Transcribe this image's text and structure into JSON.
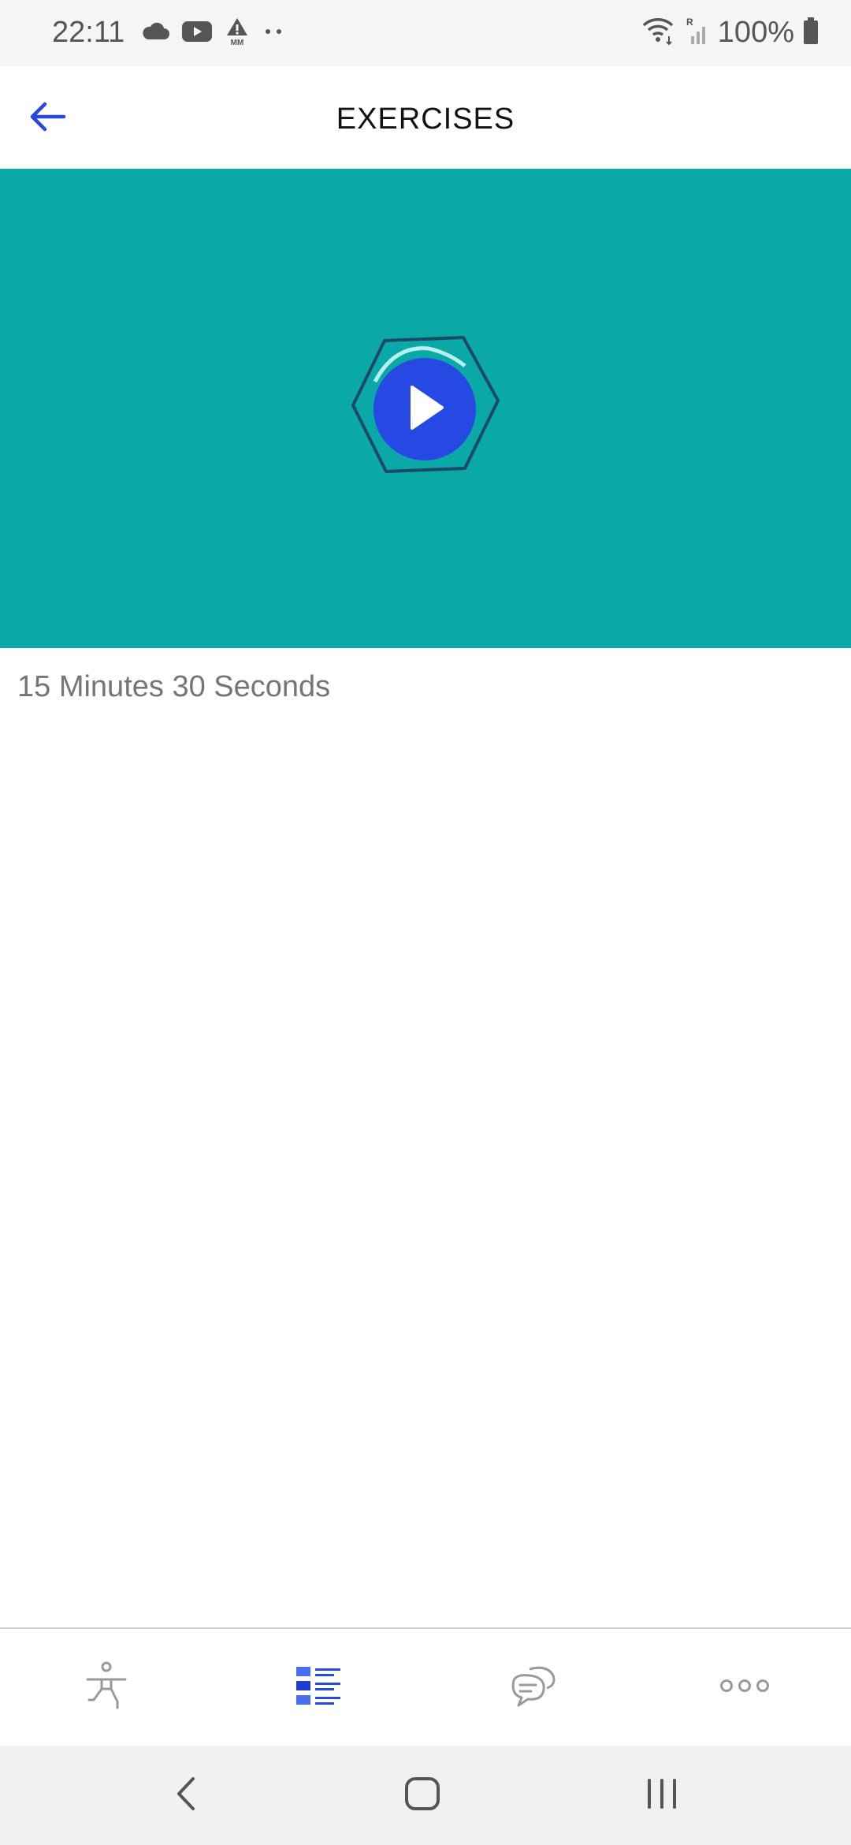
{
  "status_bar": {
    "time": "22:11",
    "battery_text": "100%",
    "icons": [
      "cloud-icon",
      "youtube-icon",
      "warning-mm-icon",
      "more-dots-icon",
      "wifi-icon",
      "signal-icon",
      "battery-icon"
    ]
  },
  "header": {
    "title": "EXERCISES",
    "back_icon": "arrow-left-icon",
    "accent_color": "#2749e3"
  },
  "video": {
    "background_color": "#0aa9a8",
    "play_icon": "play-icon"
  },
  "duration_text": "15 Minutes 30 Seconds",
  "bottom_nav": {
    "items": [
      {
        "icon": "exercise-figure-icon",
        "active": false
      },
      {
        "icon": "list-icon",
        "active": true
      },
      {
        "icon": "chat-bubbles-icon",
        "active": false
      },
      {
        "icon": "more-horizontal-icon",
        "active": false
      }
    ]
  },
  "system_nav": {
    "items": [
      "back-icon",
      "home-icon",
      "recents-icon"
    ]
  }
}
